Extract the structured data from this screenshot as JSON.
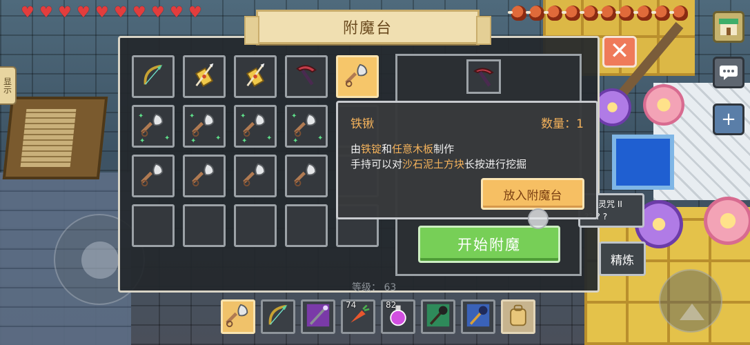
{
  "window": {
    "title": "附魔台"
  },
  "hud": {
    "hearts": 10,
    "hunger": 10,
    "side_tab_label": "显示",
    "colors": {
      "heart": "#e23d3d",
      "meat": "#e06a3a"
    }
  },
  "inventory": {
    "slots": [
      {
        "icon": "bow-icon"
      },
      {
        "icon": "arrow-bundle-icon"
      },
      {
        "icon": "arrow-bundle-icon"
      },
      {
        "icon": "pickaxe-icon"
      },
      {
        "icon": "shovel-icon",
        "selected": true
      },
      {
        "icon": "shovel-icon",
        "sparkle": true
      },
      {
        "icon": "shovel-icon",
        "sparkle": true
      },
      {
        "icon": "shovel-icon",
        "sparkle": true
      },
      {
        "icon": "shovel-icon",
        "sparkle": true
      },
      {
        "icon": "empty"
      },
      {
        "icon": "shovel-icon"
      },
      {
        "icon": "shovel-icon"
      },
      {
        "icon": "shovel-icon"
      },
      {
        "icon": "shovel-icon"
      },
      {
        "icon": "empty"
      },
      {
        "icon": "empty"
      },
      {
        "icon": "empty"
      },
      {
        "icon": "empty"
      },
      {
        "icon": "empty"
      },
      {
        "icon": "empty"
      }
    ]
  },
  "enchant": {
    "preview_item": "pickaxe-icon",
    "level_label": "等级：",
    "level_value": "63",
    "start_button": "开始附魔",
    "curse_title": "灵咒 II",
    "curse_sub": "?? ? ?",
    "refine_button": "精炼"
  },
  "tooltip": {
    "name": "铁锹",
    "count_label": "数量：",
    "count_value": "1",
    "line1_pre": "由",
    "line1_hl1": "铁锭",
    "line1_mid": "和",
    "line1_hl2": "任意木板",
    "line1_post": "制作",
    "line2_pre": "手持可以对",
    "line2_hl": "沙石泥土方块",
    "line2_post": "长按进行挖掘",
    "put_button": "放入附魔台"
  },
  "hotbar": [
    {
      "icon": "shovel-icon",
      "active": true
    },
    {
      "icon": "bow-icon"
    },
    {
      "icon": "magic-wand-icon"
    },
    {
      "icon": "carrot-icon",
      "count": "74"
    },
    {
      "icon": "potion-icon",
      "count": "82"
    },
    {
      "icon": "mace-icon"
    },
    {
      "icon": "blue-mace-icon"
    },
    {
      "icon": "backpack-icon"
    }
  ]
}
